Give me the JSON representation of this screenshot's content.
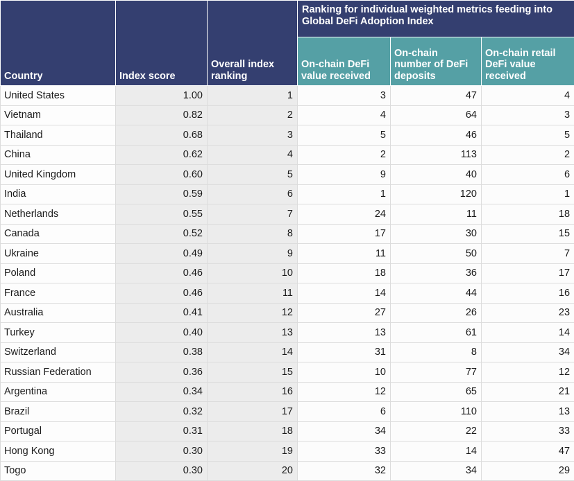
{
  "table": {
    "header": {
      "country": "Country",
      "index_score": "Index score",
      "overall_rank": "Overall index ranking",
      "group_title": "Ranking for individual weighted metrics feeding into Global DeFi Adoption Index",
      "metric_1": "On-chain DeFi value received",
      "metric_2": "On-chain number of DeFi deposits",
      "metric_3": "On-chain retail DeFi value received"
    },
    "colors": {
      "header_navy": "#343F70",
      "header_teal": "#55A0A5",
      "shaded_cell": "#ececec",
      "grid_line": "#dcdcdc"
    },
    "rows": [
      {
        "country": "United States",
        "index_score": "1.00",
        "overall_rank": "1",
        "metric_1": "3",
        "metric_2": "47",
        "metric_3": "4"
      },
      {
        "country": "Vietnam",
        "index_score": "0.82",
        "overall_rank": "2",
        "metric_1": "4",
        "metric_2": "64",
        "metric_3": "3"
      },
      {
        "country": "Thailand",
        "index_score": "0.68",
        "overall_rank": "3",
        "metric_1": "5",
        "metric_2": "46",
        "metric_3": "5"
      },
      {
        "country": "China",
        "index_score": "0.62",
        "overall_rank": "4",
        "metric_1": "2",
        "metric_2": "113",
        "metric_3": "2"
      },
      {
        "country": "United Kingdom",
        "index_score": "0.60",
        "overall_rank": "5",
        "metric_1": "9",
        "metric_2": "40",
        "metric_3": "6"
      },
      {
        "country": "India",
        "index_score": "0.59",
        "overall_rank": "6",
        "metric_1": "1",
        "metric_2": "120",
        "metric_3": "1"
      },
      {
        "country": "Netherlands",
        "index_score": "0.55",
        "overall_rank": "7",
        "metric_1": "24",
        "metric_2": "11",
        "metric_3": "18"
      },
      {
        "country": "Canada",
        "index_score": "0.52",
        "overall_rank": "8",
        "metric_1": "17",
        "metric_2": "30",
        "metric_3": "15"
      },
      {
        "country": "Ukraine",
        "index_score": "0.49",
        "overall_rank": "9",
        "metric_1": "11",
        "metric_2": "50",
        "metric_3": "7"
      },
      {
        "country": "Poland",
        "index_score": "0.46",
        "overall_rank": "10",
        "metric_1": "18",
        "metric_2": "36",
        "metric_3": "17"
      },
      {
        "country": "France",
        "index_score": "0.46",
        "overall_rank": "11",
        "metric_1": "14",
        "metric_2": "44",
        "metric_3": "16"
      },
      {
        "country": "Australia",
        "index_score": "0.41",
        "overall_rank": "12",
        "metric_1": "27",
        "metric_2": "26",
        "metric_3": "23"
      },
      {
        "country": "Turkey",
        "index_score": "0.40",
        "overall_rank": "13",
        "metric_1": "13",
        "metric_2": "61",
        "metric_3": "14"
      },
      {
        "country": "Switzerland",
        "index_score": "0.38",
        "overall_rank": "14",
        "metric_1": "31",
        "metric_2": "8",
        "metric_3": "34"
      },
      {
        "country": "Russian Federation",
        "index_score": "0.36",
        "overall_rank": "15",
        "metric_1": "10",
        "metric_2": "77",
        "metric_3": "12"
      },
      {
        "country": "Argentina",
        "index_score": "0.34",
        "overall_rank": "16",
        "metric_1": "12",
        "metric_2": "65",
        "metric_3": "21"
      },
      {
        "country": "Brazil",
        "index_score": "0.32",
        "overall_rank": "17",
        "metric_1": "6",
        "metric_2": "110",
        "metric_3": "13"
      },
      {
        "country": "Portugal",
        "index_score": "0.31",
        "overall_rank": "18",
        "metric_1": "34",
        "metric_2": "22",
        "metric_3": "33"
      },
      {
        "country": "Hong Kong",
        "index_score": "0.30",
        "overall_rank": "19",
        "metric_1": "33",
        "metric_2": "14",
        "metric_3": "47"
      },
      {
        "country": "Togo",
        "index_score": "0.30",
        "overall_rank": "20",
        "metric_1": "32",
        "metric_2": "34",
        "metric_3": "29"
      }
    ]
  }
}
